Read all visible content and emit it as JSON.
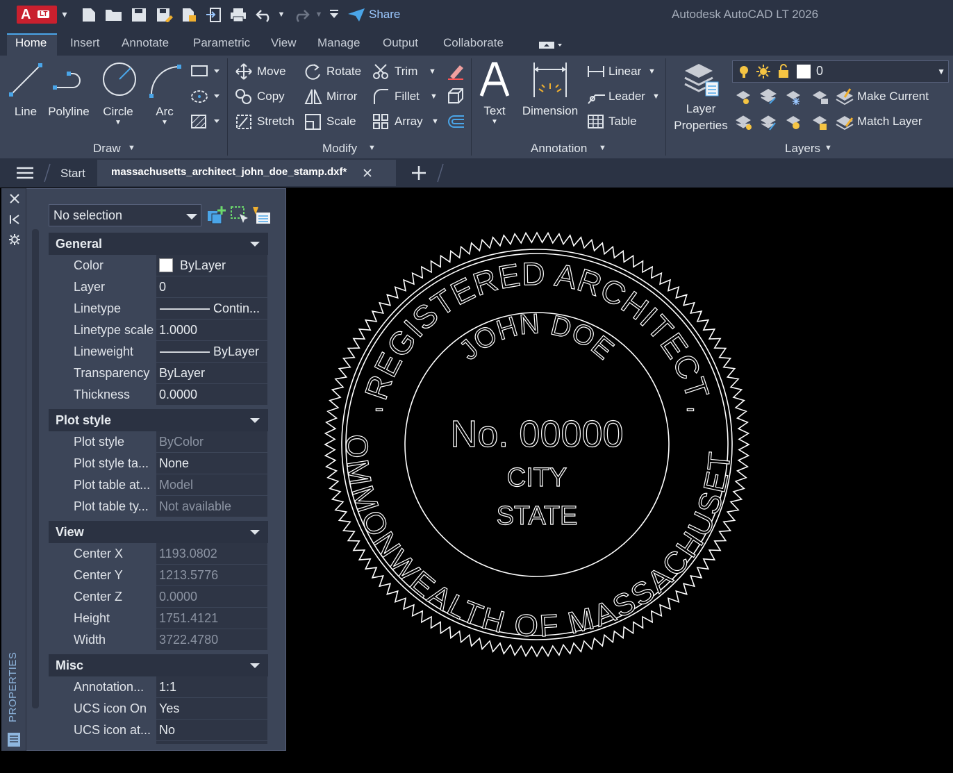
{
  "titlebar": {
    "app_badge": "A",
    "app_badge_sub": "LT",
    "share_label": "Share",
    "window_title": "Autodesk AutoCAD LT 2026"
  },
  "ribbon_tabs": [
    "Home",
    "Insert",
    "Annotate",
    "Parametric",
    "View",
    "Manage",
    "Output",
    "Collaborate"
  ],
  "ribbon": {
    "draw": {
      "label": "Draw",
      "line": "Line",
      "polyline": "Polyline",
      "circle": "Circle",
      "arc": "Arc"
    },
    "modify": {
      "label": "Modify",
      "move": "Move",
      "rotate": "Rotate",
      "trim": "Trim",
      "copy": "Copy",
      "mirror": "Mirror",
      "fillet": "Fillet",
      "stretch": "Stretch",
      "scale": "Scale",
      "array": "Array"
    },
    "annotation": {
      "label": "Annotation",
      "text": "Text",
      "dimension": "Dimension",
      "linear": "Linear",
      "leader": "Leader",
      "table": "Table"
    },
    "layers": {
      "label": "Layers",
      "layer_properties_1": "Layer",
      "layer_properties_2": "Properties",
      "current_layer": "0",
      "make_current": "Make Current",
      "match_layer": "Match Layer"
    }
  },
  "doc_tabs": {
    "start": "Start",
    "active": "massachusetts_architect_john_doe_stamp.dxf*"
  },
  "properties": {
    "palette_title": "PROPERTIES",
    "selection": "No selection",
    "sections": [
      {
        "title": "General",
        "rows": [
          {
            "key": "Color",
            "value": "ByLayer"
          },
          {
            "key": "Layer",
            "value": "0"
          },
          {
            "key": "Linetype",
            "value": "Contin..."
          },
          {
            "key": "Linetype scale",
            "value": "1.0000"
          },
          {
            "key": "Lineweight",
            "value": "ByLayer"
          },
          {
            "key": "Transparency",
            "value": "ByLayer"
          },
          {
            "key": "Thickness",
            "value": "0.0000"
          }
        ]
      },
      {
        "title": "Plot style",
        "rows": [
          {
            "key": "Plot style",
            "value": "ByColor"
          },
          {
            "key": "Plot style ta...",
            "value": "None"
          },
          {
            "key": "Plot table at...",
            "value": "Model"
          },
          {
            "key": "Plot table ty...",
            "value": "Not available"
          }
        ]
      },
      {
        "title": "View",
        "rows": [
          {
            "key": "Center X",
            "value": "1193.0802"
          },
          {
            "key": "Center Y",
            "value": "1213.5776"
          },
          {
            "key": "Center Z",
            "value": "0.0000"
          },
          {
            "key": "Height",
            "value": "1751.4121"
          },
          {
            "key": "Width",
            "value": "3722.4780"
          }
        ]
      },
      {
        "title": "Misc",
        "rows": [
          {
            "key": "Annotation...",
            "value": "1:1"
          },
          {
            "key": "UCS icon On",
            "value": "Yes"
          },
          {
            "key": "UCS icon at...",
            "value": "No"
          }
        ]
      }
    ]
  },
  "stamp": {
    "top_arc": "REGISTERED ARCHITECT",
    "bottom_arc": "COMMONWEALTH OF MASSACHUSETTS",
    "name": "JOHN DOE",
    "number": "No. 00000",
    "city": "CITY",
    "state": "STATE",
    "dash": "-"
  }
}
